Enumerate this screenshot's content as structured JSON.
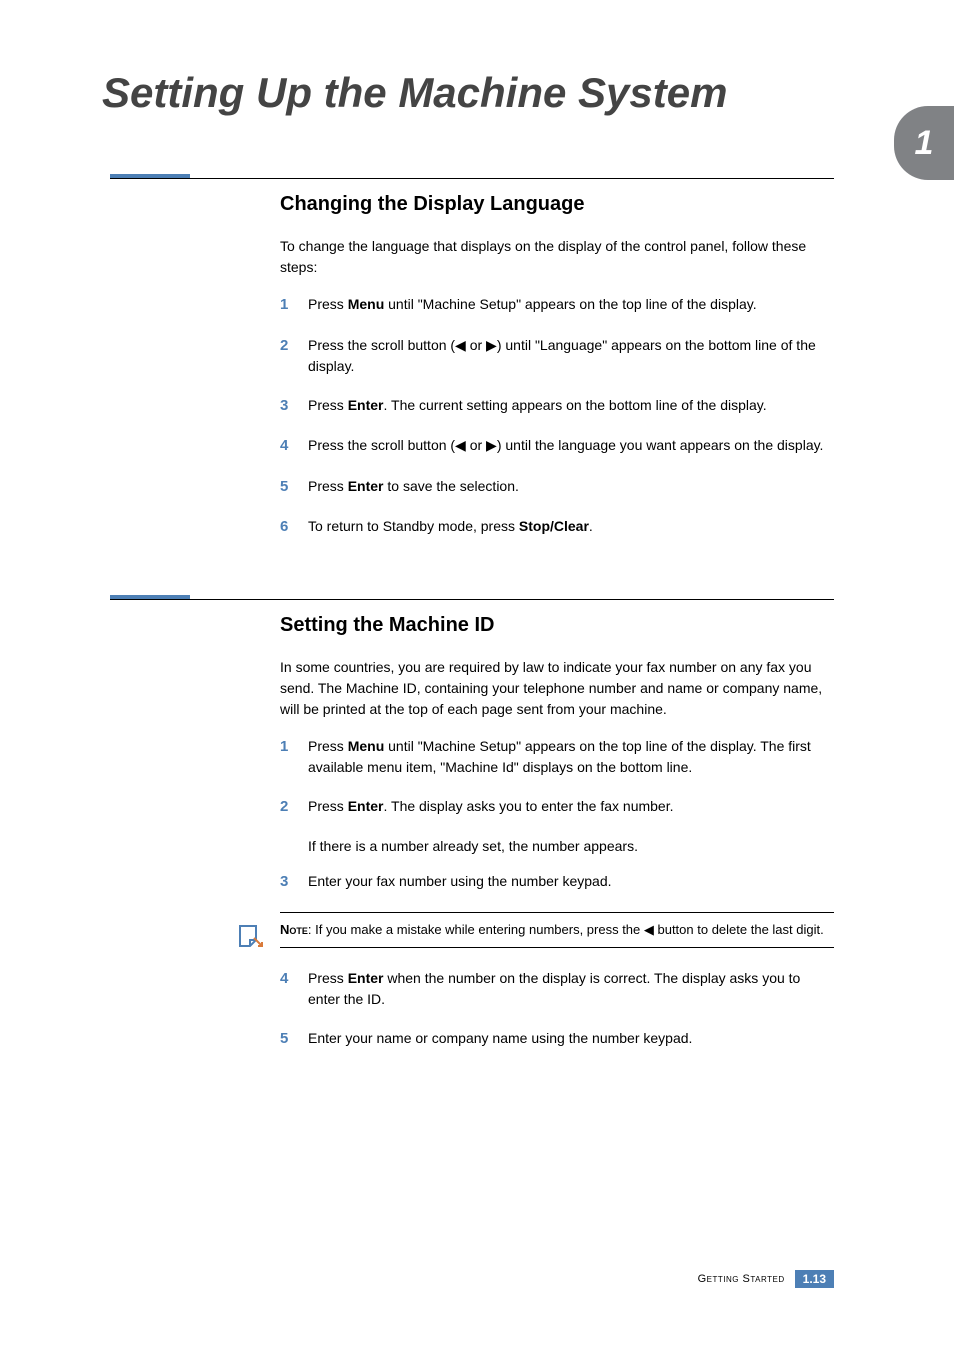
{
  "page_title": "Setting Up the Machine System",
  "chapter_number": "1",
  "sections": [
    {
      "heading": "Changing the Display Language",
      "intro": "To change the language that displays on the display of the control panel, follow these steps:",
      "steps": [
        {
          "num": "1",
          "html": "Press <b>Menu</b> until \"Machine Setup\" appears on the top line of the display."
        },
        {
          "num": "2",
          "html": "Press the scroll button (◀ or ▶) until \"Language\" appears on the bottom line of the display."
        },
        {
          "num": "3",
          "html": "Press <b>Enter</b>. The current setting appears on the bottom line of the display."
        },
        {
          "num": "4",
          "html": "Press the scroll button (◀ or ▶) until the language you want appears on the display."
        },
        {
          "num": "5",
          "html": "Press <b>Enter</b> to save the selection."
        },
        {
          "num": "6",
          "html": "To return to Standby mode, press <b>Stop/Clear</b>."
        }
      ]
    },
    {
      "heading": "Setting the Machine ID",
      "intro": "In some countries, you are required by law to indicate your fax number on any fax you send. The Machine ID, containing your telephone number and name or company name, will be printed at the top of each page sent from your machine.",
      "steps_part1": [
        {
          "num": "1",
          "html": "Press <b>Menu</b> until \"Machine Setup\" appears on the top line of the display. The first available menu item, \"Machine Id\" displays on the bottom line."
        },
        {
          "num": "2",
          "html": "Press <b>Enter</b>. The display asks you to enter the fax number."
        }
      ],
      "sub_text": "If there is a number already set, the number appears.",
      "steps_part2": [
        {
          "num": "3",
          "html": "Enter your fax number using the number keypad."
        }
      ],
      "note": {
        "label": "Note",
        "text": ": If you make a mistake while entering numbers, press the ◀ button to delete the last digit."
      },
      "steps_part3": [
        {
          "num": "4",
          "html": "Press <b>Enter</b> when the number on the display is correct. The display asks you to enter the ID."
        },
        {
          "num": "5",
          "html": "Enter your name or company name using the number keypad."
        }
      ]
    }
  ],
  "footer": {
    "section_name": "Getting Started",
    "page_number": "1.13"
  }
}
